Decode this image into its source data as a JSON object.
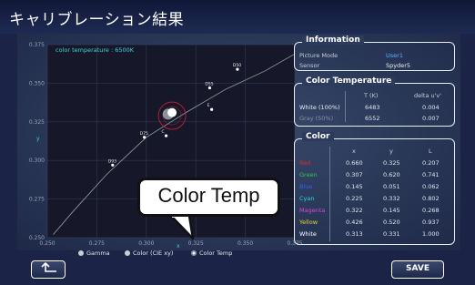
{
  "title": "キャリブレーション結果",
  "chart_data": {
    "type": "scatter",
    "title": "color temperature : 6500K",
    "xlabel": "x",
    "ylabel": "y",
    "xlim": [
      0.25,
      0.375
    ],
    "ylim": [
      0.25,
      0.375
    ],
    "x_ticks": [
      "0.250",
      "0.275",
      "0.300",
      "0.325",
      "0.350",
      "0.375"
    ],
    "y_ticks": [
      "0.375",
      "0.350",
      "0.325",
      "0.300",
      "0.275",
      "0.250"
    ],
    "planckian_locus": [
      [
        0.253,
        0.252
      ],
      [
        0.263,
        0.267
      ],
      [
        0.28,
        0.291
      ],
      [
        0.3,
        0.315
      ],
      [
        0.32,
        0.331
      ],
      [
        0.34,
        0.346
      ],
      [
        0.36,
        0.358
      ],
      [
        0.375,
        0.369
      ]
    ],
    "points": [
      {
        "label": "D65",
        "x": 0.313,
        "y": 0.329
      },
      {
        "label": "D75",
        "x": 0.299,
        "y": 0.315
      },
      {
        "label": "D55",
        "x": 0.332,
        "y": 0.347
      },
      {
        "label": "D50",
        "x": 0.346,
        "y": 0.359
      },
      {
        "label": "E",
        "x": 0.333,
        "y": 0.333
      },
      {
        "label": "C",
        "x": 0.31,
        "y": 0.316
      },
      {
        "label": "D93",
        "x": 0.283,
        "y": 0.297
      }
    ],
    "measured": {
      "white": {
        "x": 0.313,
        "y": 0.331
      },
      "gray": {
        "x": 0.311,
        "y": 0.33
      }
    },
    "target_circle": {
      "x": 0.313,
      "y": 0.329
    }
  },
  "info": {
    "title": "Information",
    "rows": [
      {
        "label": "Picture Mode",
        "value": "User1",
        "color": "#5ab4ff"
      },
      {
        "label": "Sensor",
        "value": "Spyder5",
        "color": "#e8edf4"
      }
    ]
  },
  "color_temp": {
    "title": "Color Temperature",
    "headers": [
      "T (K)",
      "delta u'v'"
    ],
    "rows": [
      {
        "label": "White (100%)",
        "t": "6483",
        "delta": "0.004"
      },
      {
        "label": "Gray (50%)",
        "t": "6552",
        "delta": "0.007"
      }
    ]
  },
  "color_table": {
    "title": "Color",
    "headers": [
      "x",
      "y",
      "L"
    ],
    "rows": [
      {
        "label": "Red",
        "color": "#e02a2a",
        "x": "0.660",
        "y": "0.325",
        "L": "0.207"
      },
      {
        "label": "Green",
        "color": "#2fc84a",
        "x": "0.307",
        "y": "0.620",
        "L": "0.741"
      },
      {
        "label": "Blue",
        "color": "#3a5cff",
        "x": "0.145",
        "y": "0.051",
        "L": "0.062"
      },
      {
        "label": "Cyan",
        "color": "#2ad4e8",
        "x": "0.225",
        "y": "0.332",
        "L": "0.802"
      },
      {
        "label": "Magenta",
        "color": "#e040e0",
        "x": "0.322",
        "y": "0.145",
        "L": "0.268"
      },
      {
        "label": "Yellow",
        "color": "#e8d42a",
        "x": "0.426",
        "y": "0.520",
        "L": "0.937"
      },
      {
        "label": "White",
        "color": "#ffffff",
        "x": "0.313",
        "y": "0.331",
        "L": "1.000"
      }
    ]
  },
  "view_options": [
    {
      "label": "Gamma",
      "selected": false
    },
    {
      "label": "Color (CIE xy)",
      "selected": false
    },
    {
      "label": "Color Temp",
      "selected": true
    }
  ],
  "buttons": {
    "back_icon": "back-arrow-icon",
    "save_label": "SAVE"
  },
  "callout": {
    "text": "Color Temp"
  }
}
